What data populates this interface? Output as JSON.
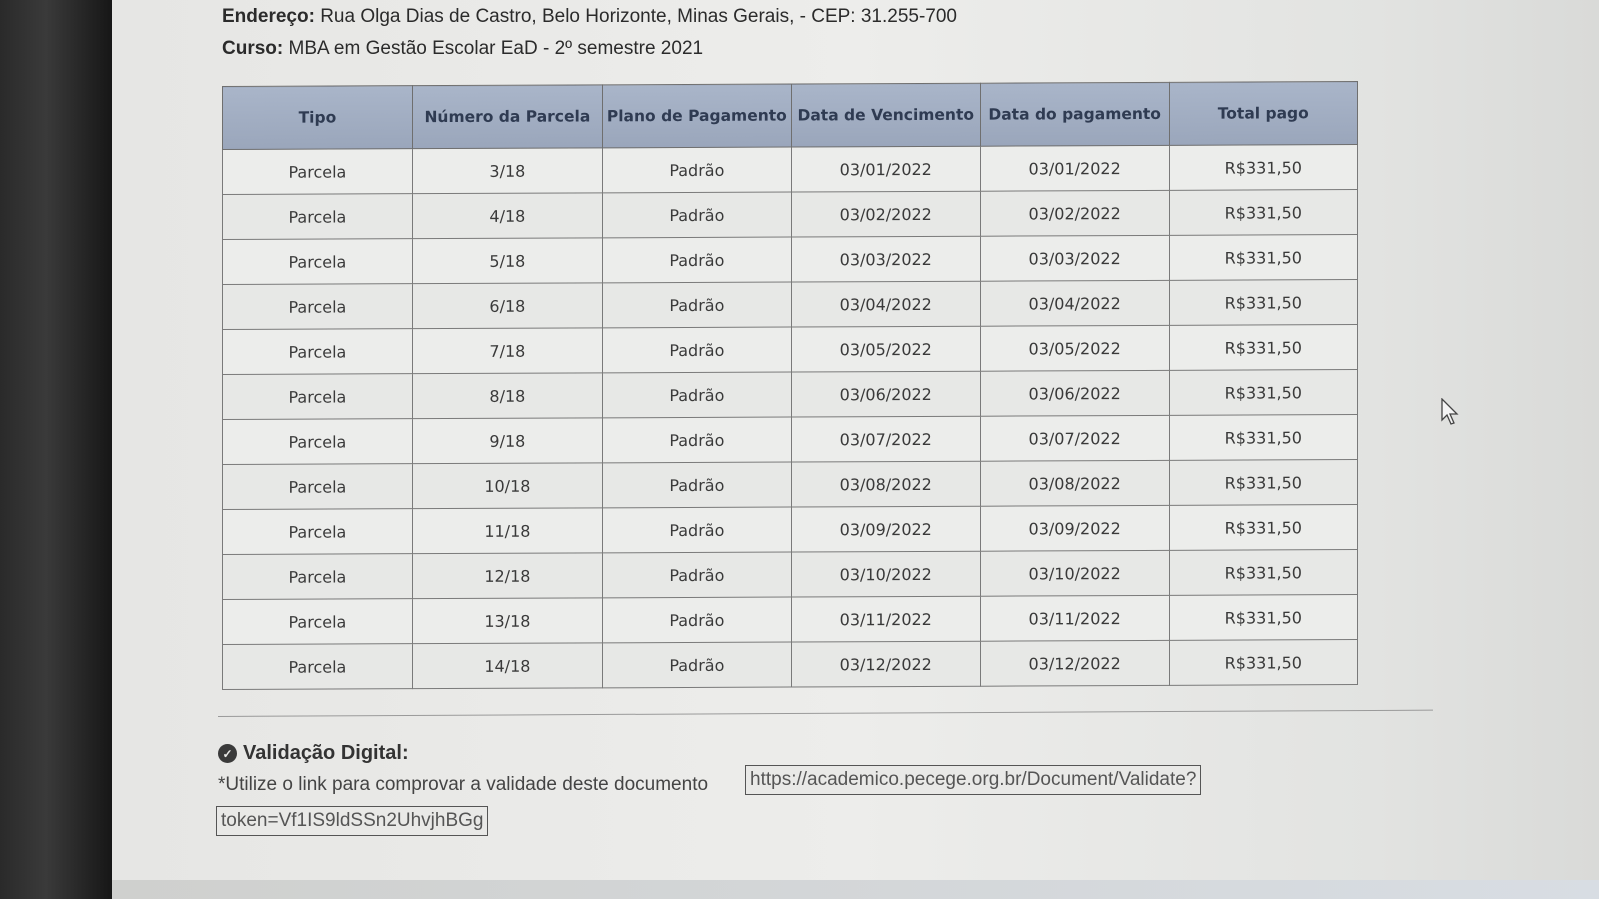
{
  "header": {
    "address_label": "Endereço:",
    "address_value": "Rua Olga Dias de Castro, Belo Horizonte, Minas Gerais, - CEP: 31.255-700",
    "course_label": "Curso:",
    "course_value": "MBA em Gestão Escolar EaD - 2º semestre 2021"
  },
  "table": {
    "columns": [
      "Tipo",
      "Número da Parcela",
      "Plano de Pagamento",
      "Data de Vencimento",
      "Data do pagamento",
      "Total pago"
    ],
    "rows": [
      [
        "Parcela",
        "3/18",
        "Padrão",
        "03/01/2022",
        "03/01/2022",
        "R$331,50"
      ],
      [
        "Parcela",
        "4/18",
        "Padrão",
        "03/02/2022",
        "03/02/2022",
        "R$331,50"
      ],
      [
        "Parcela",
        "5/18",
        "Padrão",
        "03/03/2022",
        "03/03/2022",
        "R$331,50"
      ],
      [
        "Parcela",
        "6/18",
        "Padrão",
        "03/04/2022",
        "03/04/2022",
        "R$331,50"
      ],
      [
        "Parcela",
        "7/18",
        "Padrão",
        "03/05/2022",
        "03/05/2022",
        "R$331,50"
      ],
      [
        "Parcela",
        "8/18",
        "Padrão",
        "03/06/2022",
        "03/06/2022",
        "R$331,50"
      ],
      [
        "Parcela",
        "9/18",
        "Padrão",
        "03/07/2022",
        "03/07/2022",
        "R$331,50"
      ],
      [
        "Parcela",
        "10/18",
        "Padrão",
        "03/08/2022",
        "03/08/2022",
        "R$331,50"
      ],
      [
        "Parcela",
        "11/18",
        "Padrão",
        "03/09/2022",
        "03/09/2022",
        "R$331,50"
      ],
      [
        "Parcela",
        "12/18",
        "Padrão",
        "03/10/2022",
        "03/10/2022",
        "R$331,50"
      ],
      [
        "Parcela",
        "13/18",
        "Padrão",
        "03/11/2022",
        "03/11/2022",
        "R$331,50"
      ],
      [
        "Parcela",
        "14/18",
        "Padrão",
        "03/12/2022",
        "03/12/2022",
        "R$331,50"
      ]
    ]
  },
  "validation": {
    "title": "Validação Digital:",
    "text": "*Utilize o link para comprovar a validade deste documento",
    "link_part1": "https://academico.pecege.org.br/Document/Validate?",
    "link_part2": "token=Vf1IS9ldSSn2UhvjhBGg",
    "icon": "shield-check-icon"
  }
}
